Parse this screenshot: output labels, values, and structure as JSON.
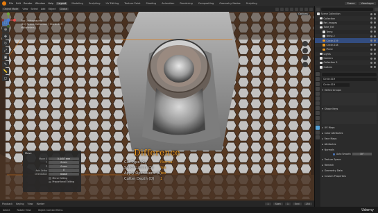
{
  "topbar": {
    "menus": [
      "File",
      "Edit",
      "Render",
      "Window",
      "Help"
    ],
    "workspaces": [
      "Layout",
      "Modeling",
      "Sculpting",
      "UV Editing",
      "Texture Paint",
      "Shading",
      "Animation",
      "Rendering",
      "Compositing",
      "Geometry Nodes",
      "Scripting"
    ],
    "active_workspace": "Layout",
    "scene": "Scene",
    "view_layer": "ViewLayer"
  },
  "viewport_header": {
    "mode": "Object Mode",
    "menus": [
      "View",
      "Select",
      "Add",
      "Object"
    ],
    "transform": "Global"
  },
  "viewport": {
    "view_name": "Top Orthographic",
    "collection": "(11) Scene Collection | Circle.019",
    "scale": "Millimeters",
    "options_label": "Options"
  },
  "operator_panel": {
    "title": "Move",
    "rows": [
      {
        "label": "Move X",
        "value": "0.4457 mm"
      },
      {
        "label": "Y",
        "value": "0 mm"
      },
      {
        "label": "Z",
        "value": "0 mm"
      },
      {
        "label": "Axis Ortho",
        "value": "X"
      },
      {
        "label": "Orientation",
        "value": "Global"
      }
    ],
    "checks": [
      "Mirror Editing",
      "Proportional Editing"
    ]
  },
  "overlay": {
    "title": "Difference",
    "commands": [
      {
        "key": "Cut Type (C)",
        "value": "Normal"
      },
      {
        "key": "Solid Cutters (S)",
        "value": "Yes"
      },
      {
        "key": "Apply Operations (A)",
        "value": "Yes"
      },
      {
        "key": "Cutter Depth (D)",
        "value": "1"
      }
    ]
  },
  "timeline": {
    "items": [
      "Playback",
      "Keying",
      "View",
      "Marker"
    ],
    "frames": [
      "1",
      "Start",
      "1",
      "End",
      "250"
    ]
  },
  "statusbar": {
    "items": [
      "Select",
      "Rotate View",
      "Object Context Menu"
    ],
    "brand": "Udemy"
  },
  "outliner": {
    "rows": [
      {
        "name": "Scene Collection",
        "color": "#e0e0e0",
        "selected": false
      },
      {
        "name": "Collection",
        "color": "#e0e0e0",
        "selected": false
      },
      {
        "name": "Ref_Images",
        "color": "#e0e0e0",
        "selected": false
      },
      {
        "name": "Tube_Ext",
        "color": "#e0e0e0",
        "selected": false
      },
      {
        "name": "Temp",
        "color": "#e0e0e0",
        "selected": false
      },
      {
        "name": "Temp 2",
        "color": "#e0e0e0",
        "selected": false
      },
      {
        "name": "Circle.019",
        "color": "#e89820",
        "selected": true
      },
      {
        "name": "Circle.018",
        "color": "#e89820",
        "selected": false
      },
      {
        "name": "Plane",
        "color": "#e89820",
        "selected": false
      },
      {
        "name": "Lights",
        "color": "#e0e0e0",
        "selected": false
      },
      {
        "name": "Camera",
        "color": "#e0e0e0",
        "selected": false
      },
      {
        "name": "Collection 2",
        "color": "#e0e0e0",
        "selected": false
      },
      {
        "name": "Cutters",
        "color": "#e0e0e0",
        "selected": false
      }
    ]
  },
  "properties": {
    "object_name": "Circle.019",
    "data_name": "Circle.019",
    "sections": [
      {
        "label": "Vertex Groups",
        "closed": false
      },
      {
        "label": "Shape Keys",
        "closed": false
      },
      {
        "label": "UV Maps",
        "closed": true
      },
      {
        "label": "Color Attributes",
        "closed": true
      },
      {
        "label": "Face Maps",
        "closed": true
      },
      {
        "label": "Attributes",
        "closed": true
      },
      {
        "label": "Normals",
        "closed": false
      }
    ],
    "auto_smooth_label": "Auto Smooth",
    "auto_smooth_value": "30°",
    "more_sections": [
      "Texture Space",
      "Remesh",
      "Geometry Data",
      "Custom Properties"
    ]
  }
}
